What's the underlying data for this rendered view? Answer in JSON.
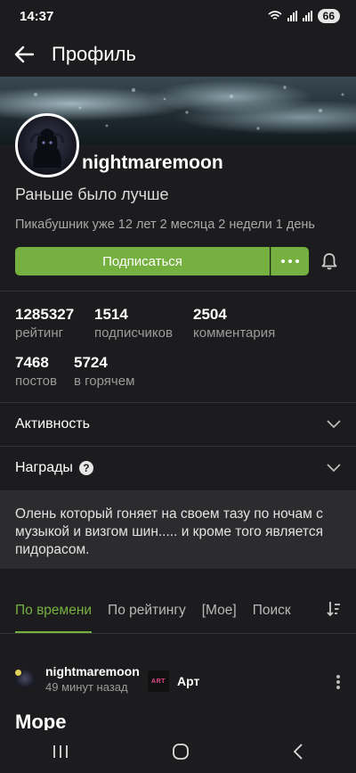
{
  "status": {
    "time": "14:37",
    "battery": "66"
  },
  "header": {
    "title": "Профиль"
  },
  "profile": {
    "username": "nightmaremoon",
    "motto": "Раньше было лучше",
    "since": "Пикабушник уже 12 лет 2 месяца 2 недели 1 день",
    "subscribe_label": "Подписаться"
  },
  "stats": [
    {
      "value": "1285327",
      "label": "рейтинг"
    },
    {
      "value": "1514",
      "label": "подписчиков"
    },
    {
      "value": "2504",
      "label": "комментария"
    },
    {
      "value": "7468",
      "label": "постов"
    },
    {
      "value": "5724",
      "label": "в горячем"
    }
  ],
  "sections": {
    "activity": "Активность",
    "awards": "Награды",
    "awards_help": "?"
  },
  "about": "Олень который гоняет на своем тазу по ночам с музыкой и визгом шин..... и кроме того является пидорасом.",
  "tabs": [
    "По времени",
    "По рейтингу",
    "[Мое]",
    "Поиск"
  ],
  "post": {
    "author": "nightmaremoon",
    "time": "49 минут назад",
    "community_logo": "ART",
    "community": "Арт",
    "title": "Море"
  },
  "colors": {
    "accent": "#76b041",
    "background": "#1c1c1e",
    "about_bg": "#2c2c2e"
  }
}
